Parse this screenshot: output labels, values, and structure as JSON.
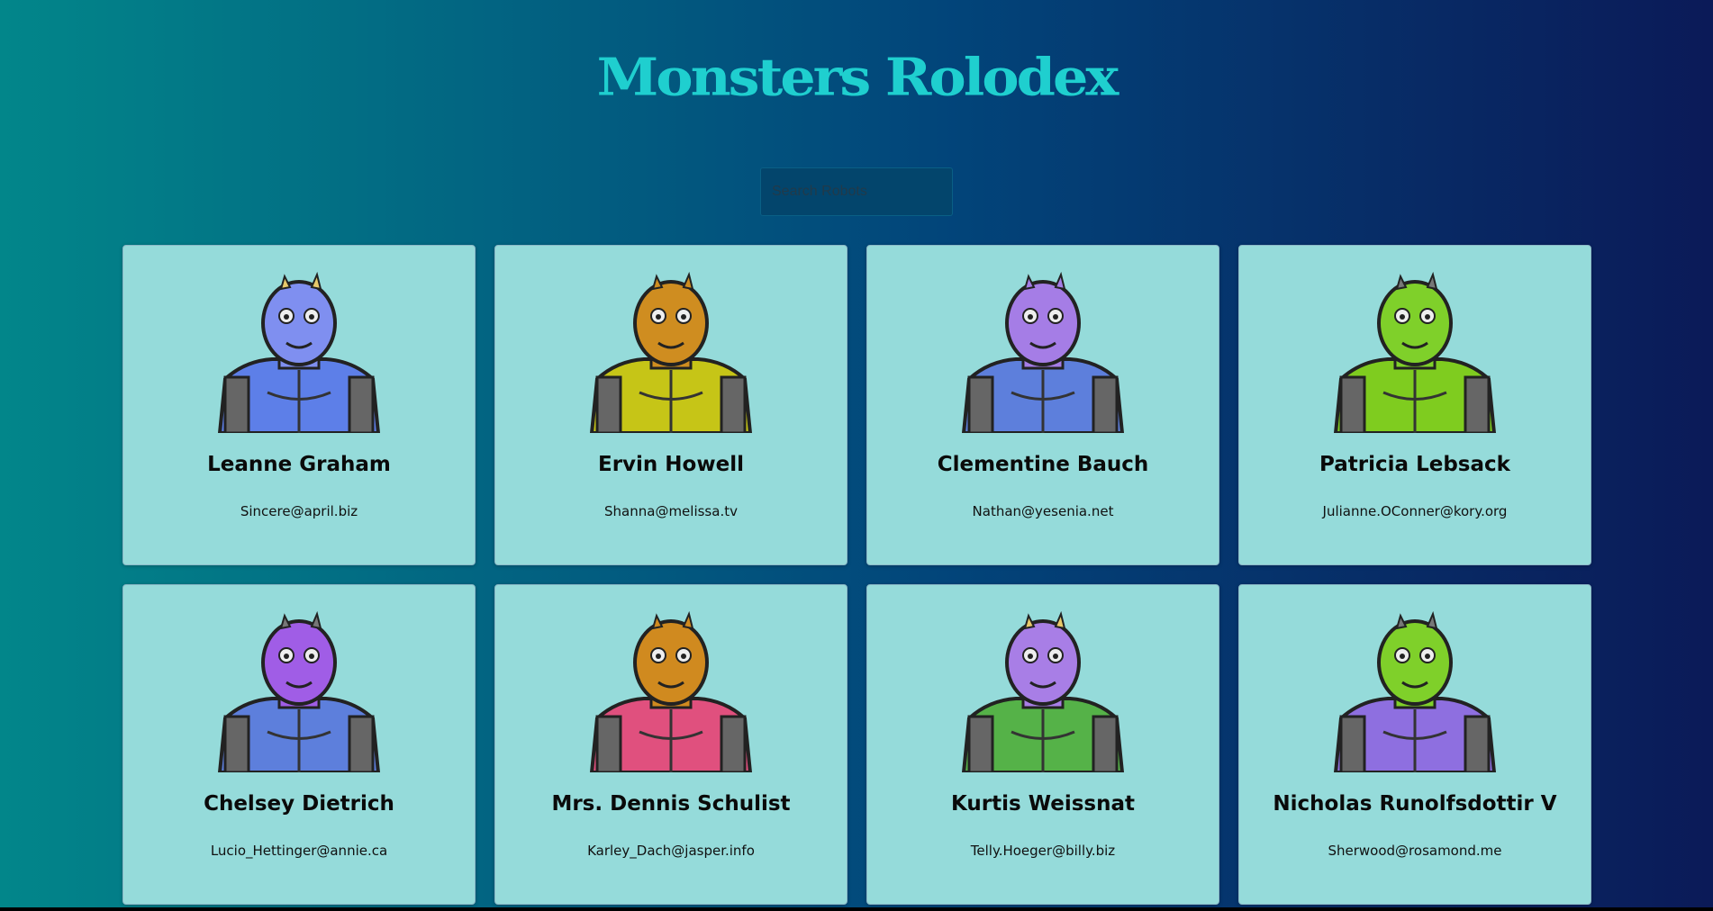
{
  "header": {
    "title": "Monsters Rolodex"
  },
  "search": {
    "placeholder": "Search Robots",
    "value": ""
  },
  "monsters": [
    {
      "name": "Leanne Graham",
      "email": "Sincere@april.biz",
      "body": "#5d7fe8",
      "head": "#7f8ff0",
      "horn": "#e8c96a"
    },
    {
      "name": "Ervin Howell",
      "email": "Shanna@melissa.tv",
      "body": "#c6c517",
      "head": "#cf8d20",
      "horn": "#cf8d20"
    },
    {
      "name": "Clementine Bauch",
      "email": "Nathan@yesenia.net",
      "body": "#5d7fdc",
      "head": "#a57de6",
      "horn": "#a57de6"
    },
    {
      "name": "Patricia Lebsack",
      "email": "Julianne.OConner@kory.org",
      "body": "#7fcc1f",
      "head": "#7fd02a",
      "horn": "#777"
    },
    {
      "name": "Chelsey Dietrich",
      "email": "Lucio_Hettinger@annie.ca",
      "body": "#5d7fdc",
      "head": "#a05de6",
      "horn": "#777"
    },
    {
      "name": "Mrs. Dennis Schulist",
      "email": "Karley_Dach@jasper.info",
      "body": "#e0507e",
      "head": "#d08a1f",
      "horn": "#d08a1f"
    },
    {
      "name": "Kurtis Weissnat",
      "email": "Telly.Hoeger@billy.biz",
      "body": "#55b248",
      "head": "#a87ee6",
      "horn": "#e8c96a"
    },
    {
      "name": "Nicholas Runolfsdottir V",
      "email": "Sherwood@rosamond.me",
      "body": "#8e6fe0",
      "head": "#7fd02a",
      "horn": "#777"
    }
  ]
}
